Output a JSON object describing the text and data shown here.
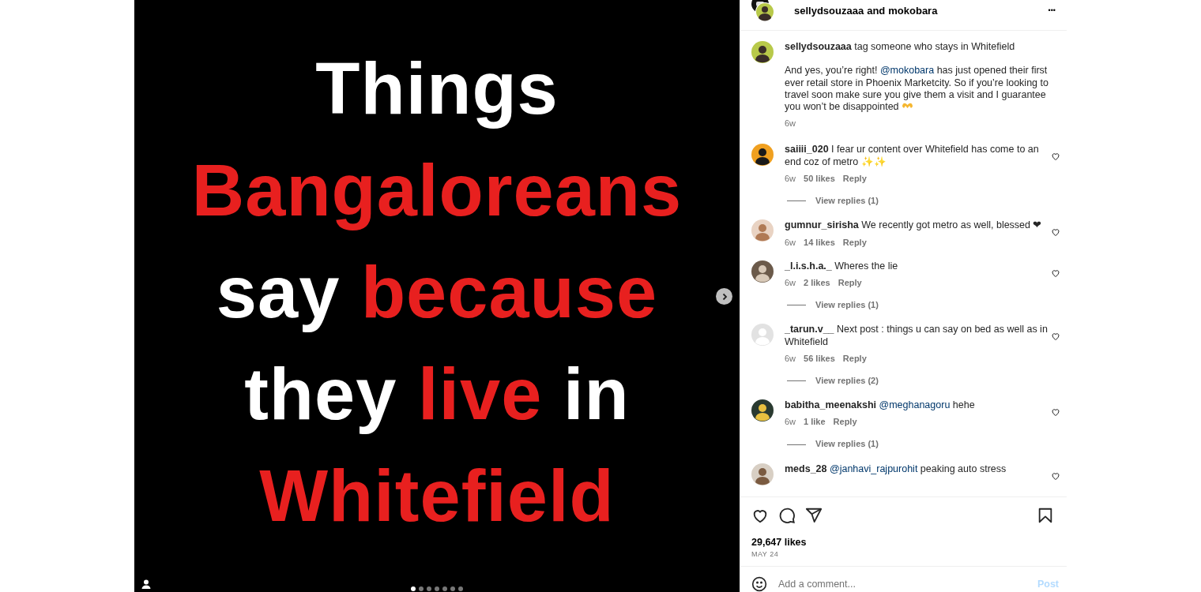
{
  "post": {
    "slide_lines": [
      [
        {
          "text": "Things",
          "color": "#ffffff"
        }
      ],
      [
        {
          "text": "Bangaloreans",
          "color": "#e8201f"
        }
      ],
      [
        {
          "text": "say ",
          "color": "#ffffff"
        },
        {
          "text": "because",
          "color": "#e8201f"
        }
      ],
      [
        {
          "text": "they ",
          "color": "#ffffff"
        },
        {
          "text": "live",
          "color": "#e8201f"
        },
        {
          "text": " in",
          "color": "#ffffff"
        }
      ],
      [
        {
          "text": "Whitefield",
          "color": "#e8201f"
        }
      ]
    ],
    "dots": [
      {
        "selected": true
      },
      {
        "selected": false
      },
      {
        "selected": false
      },
      {
        "selected": false
      },
      {
        "selected": false
      },
      {
        "selected": false
      },
      {
        "selected": false
      }
    ]
  },
  "header": {
    "author": "sellydsouzaaa",
    "joiner": "and",
    "collaborator": "mokobara",
    "more": "•••"
  },
  "caption": {
    "user": "sellydsouzaaa",
    "first_line": "tag someone who stays in Whitefield",
    "body": [
      {
        "kind": "text",
        "text": "And yes, you’re right! "
      },
      {
        "kind": "mention",
        "text": "@mokobara"
      },
      {
        "kind": "text",
        "text": " has just opened their first ever retail store in Phoenix Marketcity. So if you’re looking to travel soon make sure you give them a visit and I guarantee you won’t be disappointed"
      }
    ],
    "time": "6w"
  },
  "comments": [
    {
      "user": "saiiii_020",
      "parts": [
        {
          "kind": "text",
          "text": "I fear ur content over Whitefield has come to an end coz of metro ✨✨"
        }
      ],
      "time": "6w",
      "likes": "50 likes",
      "reply": "Reply",
      "view_replies": "View replies (1)"
    },
    {
      "user": "gumnur_sirisha",
      "parts": [
        {
          "kind": "text",
          "text": "We recently got metro as well, blessed ❤"
        }
      ],
      "time": "6w",
      "likes": "14 likes",
      "reply": "Reply"
    },
    {
      "user": "_l.i.s.h.a._",
      "parts": [
        {
          "kind": "text",
          "text": "Wheres the lie"
        }
      ],
      "time": "6w",
      "likes": "2 likes",
      "reply": "Reply",
      "view_replies": "View replies (1)"
    },
    {
      "user": "_tarun.v__",
      "parts": [
        {
          "kind": "text",
          "text": "Next post : things u can say on bed as well as in Whitefield"
        }
      ],
      "time": "6w",
      "likes": "56 likes",
      "reply": "Reply",
      "view_replies": "View replies (2)"
    },
    {
      "user": "babitha_meenakshi",
      "parts": [
        {
          "kind": "mention",
          "text": "@meghanagoru"
        },
        {
          "kind": "text",
          "text": " hehe"
        }
      ],
      "time": "6w",
      "likes": "1 like",
      "reply": "Reply",
      "view_replies": "View replies (1)"
    },
    {
      "user": "meds_28",
      "parts": [
        {
          "kind": "mention",
          "text": "@janhavi_rajpurohit"
        },
        {
          "kind": "text",
          "text": " peaking auto stress"
        }
      ]
    }
  ],
  "footer": {
    "likes": "29,647 likes",
    "date": "MAY 24",
    "comment_placeholder": "Add a comment...",
    "post_button": "Post"
  }
}
